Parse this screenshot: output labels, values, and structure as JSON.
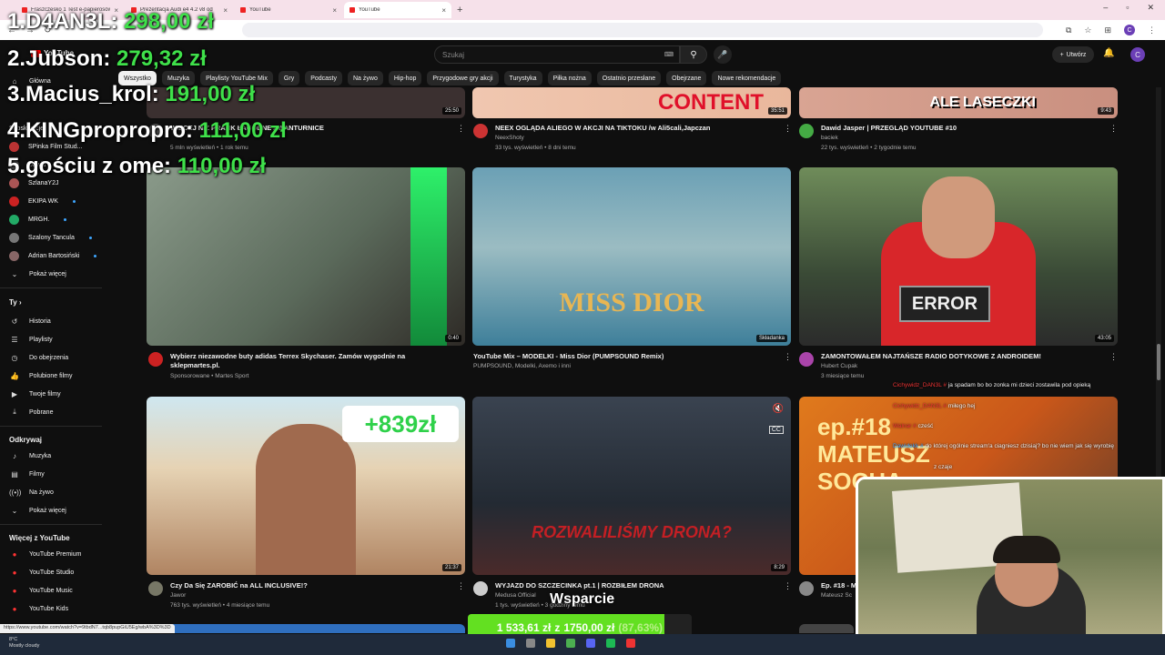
{
  "browser": {
    "tabs": [
      {
        "title": "Fraszczesko 1 Test e-papierosów"
      },
      {
        "title": "Prezentacja Audi e4 4.2 v8 od"
      },
      {
        "title": "YouTube"
      },
      {
        "title": "YouTube"
      }
    ],
    "status_url": "https://www.youtube.com/watch?v=9tbdN7...tqb8pupGiU5Eg/wbA%3D%3D"
  },
  "youtube": {
    "logo": "YouTube",
    "logo_region": "PL",
    "search_placeholder": "Szukaj",
    "create_label": "Utwórz",
    "avatar_letter": "C",
    "chips": [
      "Wszystko",
      "Muzyka",
      "Playlisty YouTube Mix",
      "Gry",
      "Podcasty",
      "Na żywo",
      "Hip-hop",
      "Przygodowe gry akcji",
      "Turystyka",
      "Piłka nożna",
      "Ostatnio przesłane",
      "Obejrzane",
      "Nowe rekomendacje"
    ],
    "sidebar": {
      "home": "Główna",
      "subs_header": "Subskrypcje",
      "channels": [
        "SPinka Film Stud...",
        "Dawid",
        "SzlanaY2J",
        "EKIPA WK",
        "MRGH.",
        "Szalony Tancula",
        "Adrian Bartosiński"
      ],
      "show_more": "Pokaż więcej",
      "you_header": "Ty",
      "you_items": [
        "Historia",
        "Playlisty",
        "Do obejrzenia",
        "Polubione filmy",
        "Twoje filmy",
        "Pobrane"
      ],
      "explore_header": "Odkrywaj",
      "explore_items": [
        "Muzyka",
        "Filmy",
        "Na żywo",
        "Pokaż więcej"
      ],
      "more_header": "Więcej z YouTube",
      "more_items": [
        "YouTube Premium",
        "YouTube Studio",
        "YouTube Music",
        "YouTube Kids"
      ]
    },
    "videos": [
      {
        "title": "NEEX OGLĄDA ALIEGO W AKCJI NA TIKTOKU /w Ali5cali,Japczan",
        "channel": "NeexShoty",
        "meta": "33 tys. wyświetleń • 8 dni temu",
        "duration": "35:51",
        "banner": "CONTENT"
      },
      {
        "title": "Dawid Jasper | PRZEGLĄD YOUTUBE #10",
        "channel": "baciek",
        "meta": "22 tys. wyświetleń • 2 tygodnie temu",
        "duration": "9:43",
        "banner": "ALE LASECZKI"
      },
      {
        "title": "WIĘCEJ NIŻ PRANK ŁAGODNE AWANTURNICE",
        "channel": "",
        "meta": "5 mln wyświetleń • 1 rok temu",
        "duration": "25:50",
        "banner": ""
      },
      {
        "title": "Wybierz niezawodne buty adidas Terrex Skychaser. Zamów wygodnie na sklepmartes.pl.",
        "channel": "Sponsorowane • Martes Sport",
        "meta": "",
        "duration": "0:40",
        "banner": ""
      },
      {
        "title": "YouTube Mix – MODELKI - Miss Dior (PUMPSOUND Remix)",
        "channel": "PUMPSOUND, Modelki, Axemo i inni",
        "meta": "",
        "duration": "Składanka",
        "banner": "MISS DIOR"
      },
      {
        "title": "ZAMONTOWAŁEM NAJTAŃSZE RADIO DOTYKOWE Z ANDROIDEM!",
        "channel": "Hubert Cupak",
        "meta": "3 miesiące temu",
        "duration": "43:05",
        "banner": "ERROR"
      },
      {
        "title": "Czy Da Się ZAROBIĆ na ALL INCLUSIVE!?",
        "channel": "Jawor",
        "meta": "763 tys. wyświetleń • 4 miesiące temu",
        "duration": "21:37",
        "banner": "+839zł"
      },
      {
        "title": "WYJAZD DO SZCZECINKA pt.1 | ROZBIŁEM DRONA",
        "channel": "Medusa Official",
        "meta": "1 tys. wyświetleń • 3 godziny temu",
        "duration": "8:29",
        "banner": "ROZWALILIŚMY DRONA?"
      },
      {
        "title": "Ep. #18 - MATEUSZ SOCHA",
        "channel": "Mateusz Sc",
        "meta": "",
        "duration": "",
        "banner": "ep.#18 MATEUSZ SOCHA"
      }
    ]
  },
  "overlay": {
    "leaderboard": [
      {
        "rank_name": "1.D4AN3L:",
        "amount": "298,00 zł"
      },
      {
        "rank_name": "2.Jubson:",
        "amount": "279,32 zł"
      },
      {
        "rank_name": "3.Macius_krol:",
        "amount": "191,00 zł"
      },
      {
        "rank_name": "4.KINGpropropro:",
        "amount": "111,00 zł"
      },
      {
        "rank_name": "5.gościu z ome:",
        "amount": "110,00 zł"
      }
    ],
    "chat": [
      {
        "user": "Cichywidz_DAN3L #",
        "text": "ja spadam bo bo zonka mi dzieci zostawila pod opieką"
      },
      {
        "user": "Cichywidz_DAN3L #",
        "text": "miłego hej"
      },
      {
        "user": "Walnar #",
        "text": "cześć"
      },
      {
        "user": "Dawidekk #",
        "text": "do której ogólnie stream'a ciagniesz dzisiaj? bo nie wiem jak się wyrobię"
      },
      {
        "user": "",
        "text": "z czaje"
      }
    ],
    "donation": {
      "label": "Wsparcie",
      "current": "1 533,61 zł",
      "separator": "z",
      "goal": "1750,00 zł",
      "percent_text": "(87,63%)",
      "fraction": 0.8763,
      "fill_color": "#63e021"
    }
  },
  "taskbar": {
    "temp": "8°C",
    "weather": "Mostly cloudy"
  }
}
